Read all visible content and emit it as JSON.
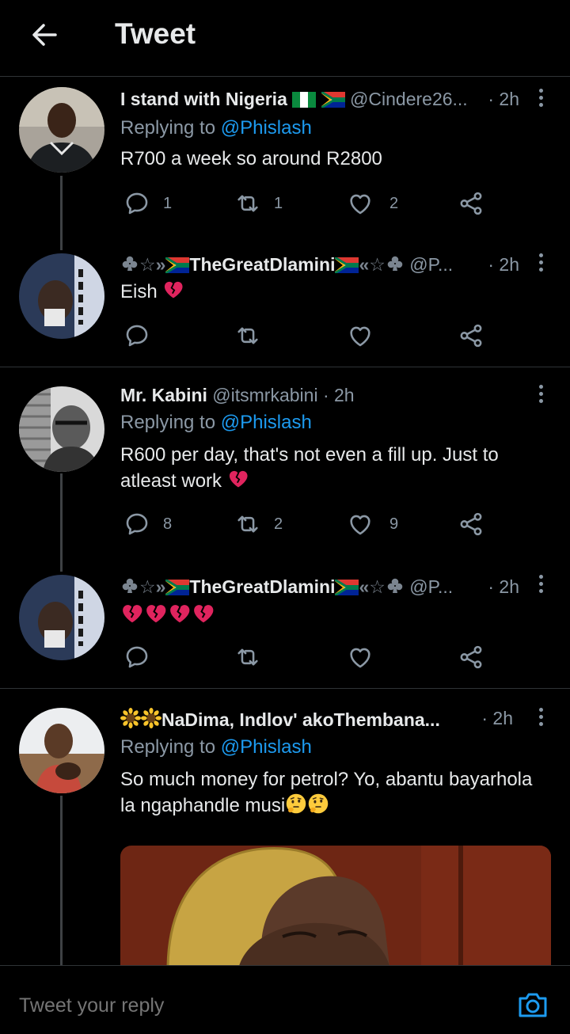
{
  "header": {
    "title": "Tweet"
  },
  "tweets": [
    {
      "name": "I stand with Nigeria",
      "handle": "@Cindere26...",
      "time": "· 2h",
      "replying_prefix": "Replying to ",
      "replying_to": "@Phislash",
      "text": "R700 a week so around R2800",
      "reply_count": "1",
      "retweet_count": "1",
      "like_count": "2"
    },
    {
      "name": "TheGreatDlamini",
      "handle": "@P...",
      "time": "· 2h",
      "text": "Eish"
    },
    {
      "name": "Mr. Kabini",
      "handle": "@itsmrkabini",
      "time": "· 2h",
      "replying_prefix": "Replying to ",
      "replying_to": "@Phislash",
      "text": "R600 per day, that's not even a fill up. Just to atleast work",
      "reply_count": "8",
      "retweet_count": "2",
      "like_count": "9"
    },
    {
      "name": "TheGreatDlamini",
      "handle": "@P...",
      "time": "· 2h",
      "text": ""
    },
    {
      "name": "NaDima, Indlov' akoThembana...",
      "handle": "",
      "time": "· 2h",
      "replying_prefix": "Replying to ",
      "replying_to": "@Phislash",
      "text": "So much money for petrol? Yo, abantu bayarhola la ngaphandle musi"
    }
  ],
  "composer": {
    "placeholder": "Tweet your reply"
  },
  "colors": {
    "accent": "#1d9bf0",
    "secondary_text": "#8b98a5",
    "divider": "#2f3336",
    "broken_heart": "#e0245e"
  },
  "icons": [
    "back-arrow-icon",
    "more-icon",
    "reply-icon",
    "retweet-icon",
    "like-icon",
    "share-icon",
    "camera-icon",
    "broken-heart-icon",
    "thinking-face-icon",
    "sunflower-icon",
    "club-suit-icon"
  ]
}
